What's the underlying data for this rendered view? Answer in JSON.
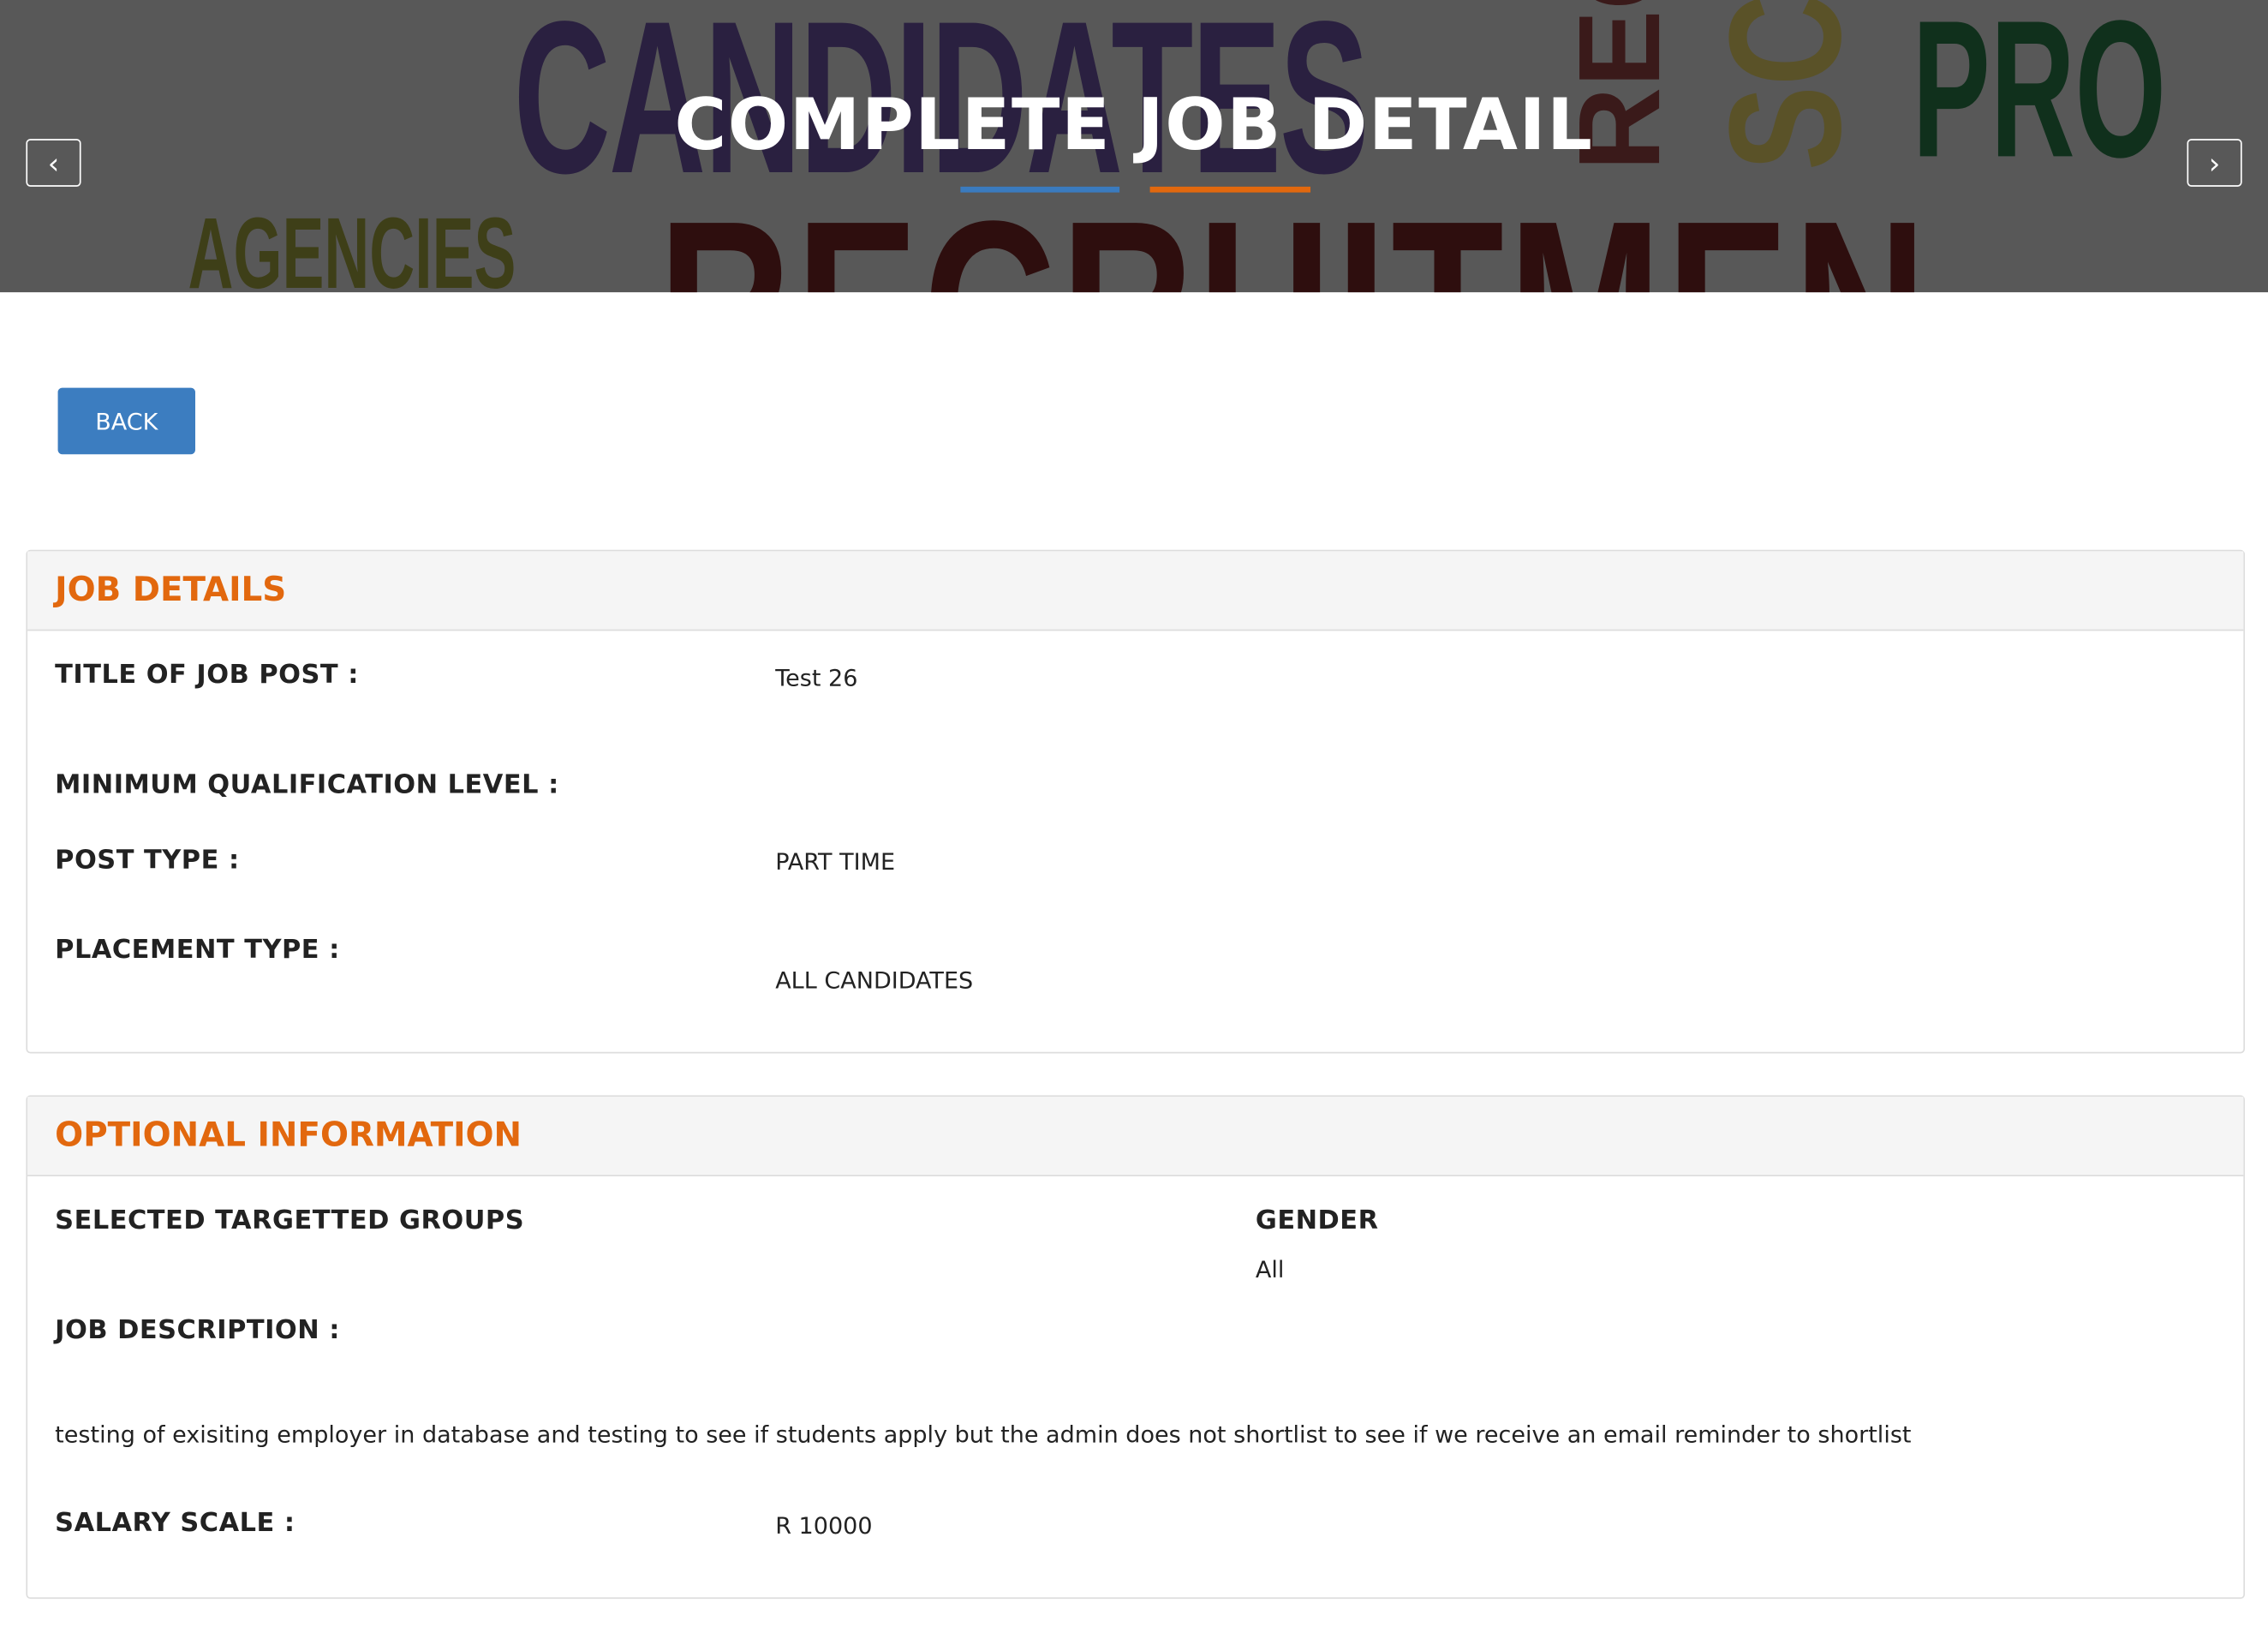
{
  "banner": {
    "title": "COMPLETE JOB DETAIL",
    "background_words": [
      "CANDIDATES",
      "REC",
      "SC",
      "PRO",
      "AGENCIES",
      "RECRUITMEN"
    ],
    "prev_icon": "chevron-left-icon",
    "next_icon": "chevron-right-icon",
    "prev_glyph": "‹",
    "next_glyph": "›",
    "accent_colors": {
      "blue": "#3a7bbf",
      "orange": "#e2680e"
    }
  },
  "back_button": {
    "label": "BACK",
    "color": "#3c7dc0"
  },
  "job_details": {
    "heading": "JOB DETAILS",
    "title_label": "TITLE OF JOB POST :",
    "title_value": "Test 26",
    "qualification_label": "MINIMUM QUALIFICATION LEVEL :",
    "qualification_value": "",
    "post_type_label": "POST TYPE :",
    "post_type_value": "PART TIME",
    "placement_type_label": "PLACEMENT TYPE :",
    "placement_type_value": "ALL CANDIDATES"
  },
  "optional_information": {
    "heading": "OPTIONAL INFORMATION",
    "targeted_groups_label": "SELECTED TARGETTED GROUPS",
    "targeted_groups_value": "",
    "gender_label": "GENDER",
    "gender_value": "All",
    "job_description_label": "JOB DESCRIPTION :",
    "job_description_value": "testing of exisiting employer in database and testing to see if students apply but the admin does not shortlist to see if we receive an email reminder to shortlist",
    "salary_scale_label": "SALARY SCALE :",
    "salary_scale_value": "R 10000"
  }
}
